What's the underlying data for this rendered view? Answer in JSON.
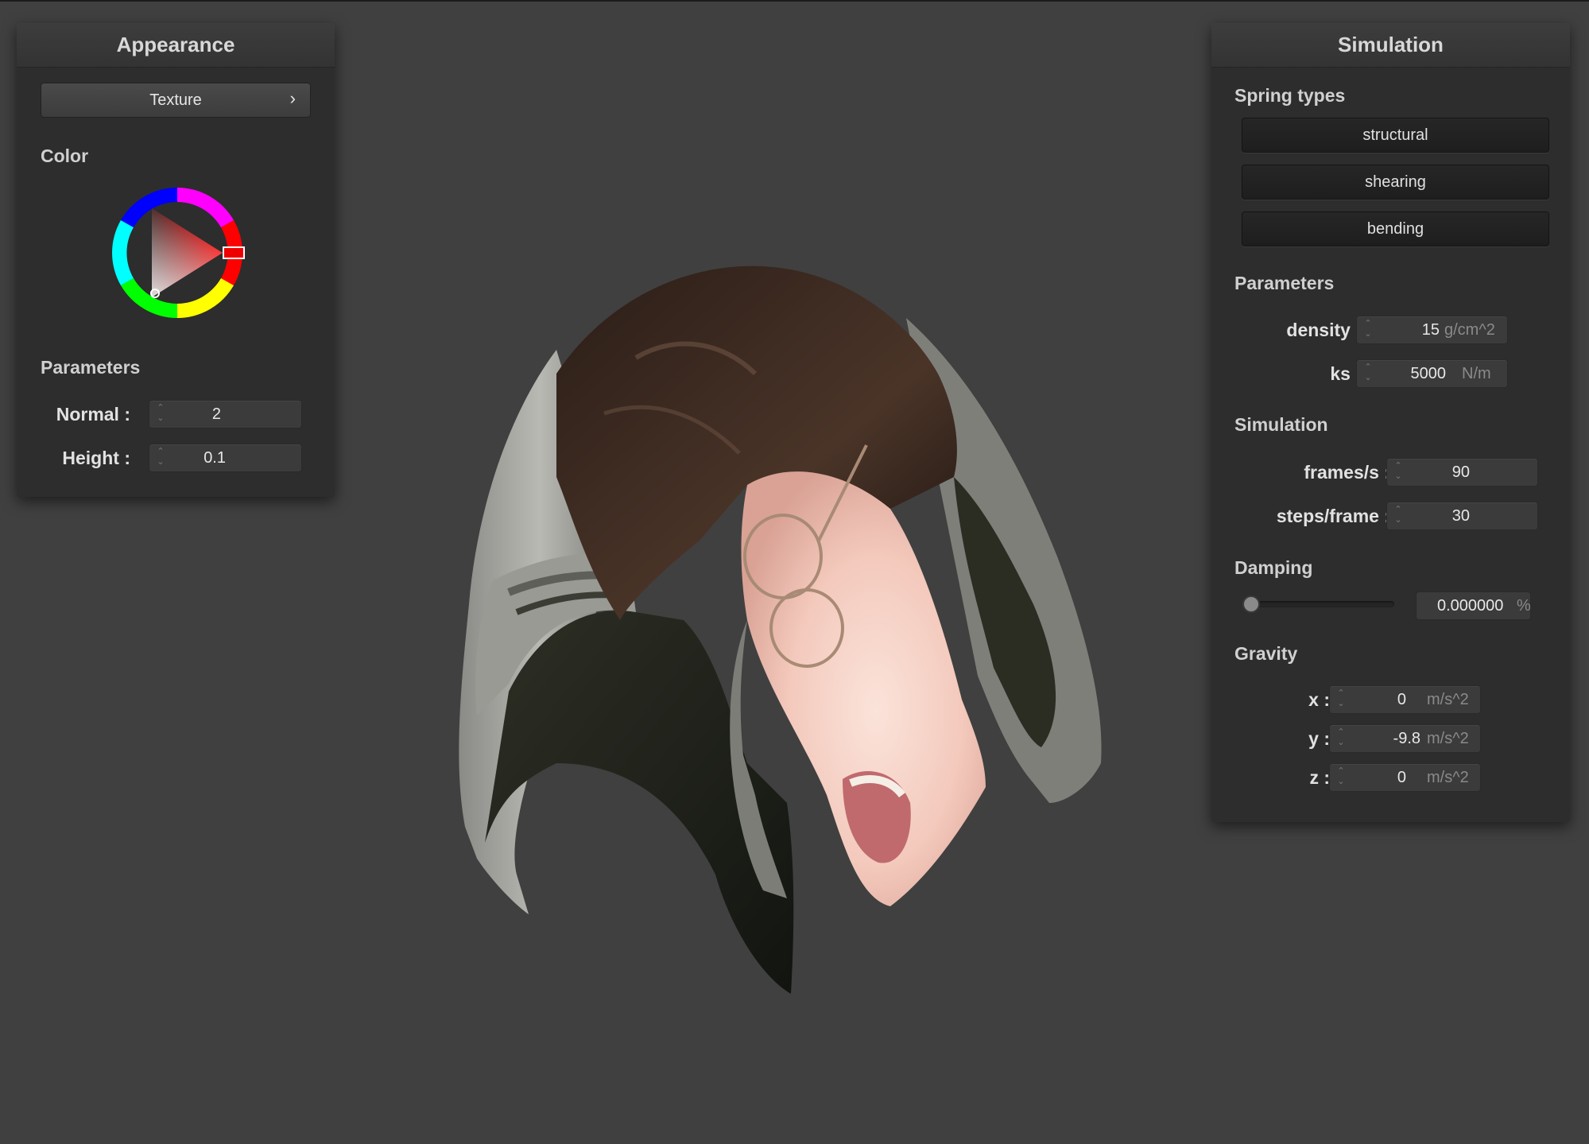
{
  "appearance": {
    "title": "Appearance",
    "texture_button": "Texture",
    "texture_chevron": "›",
    "color_heading": "Color",
    "color_value": "#ff0000",
    "parameters_heading": "Parameters",
    "normal": {
      "label": "Normal :",
      "value": "2"
    },
    "height": {
      "label": "Height :",
      "value": "0.1"
    }
  },
  "simulation": {
    "title": "Simulation",
    "spring_types_heading": "Spring types",
    "spring_types": [
      "structural",
      "shearing",
      "bending"
    ],
    "parameters_heading": "Parameters",
    "density": {
      "label": "density :",
      "value": "15",
      "unit": "g/cm^2"
    },
    "ks": {
      "label": "ks :",
      "value": "5000",
      "unit": "N/m"
    },
    "simulation_heading": "Simulation",
    "frames": {
      "label": "frames/s :",
      "value": "90"
    },
    "steps": {
      "label": "steps/frame :",
      "value": "30"
    },
    "damping_heading": "Damping",
    "damping": {
      "value": "0.000000",
      "unit": "%",
      "fraction": 0.0
    },
    "gravity_heading": "Gravity",
    "gravity_x": {
      "label": "x :",
      "value": "0",
      "unit": "m/s^2"
    },
    "gravity_y": {
      "label": "y :",
      "value": "-9.8",
      "unit": "m/s^2"
    },
    "gravity_z": {
      "label": "z :",
      "value": "0",
      "unit": "m/s^2"
    }
  },
  "icons": {
    "spinner": "up-down-arrows-icon",
    "chevron": "chevron-right-icon"
  }
}
